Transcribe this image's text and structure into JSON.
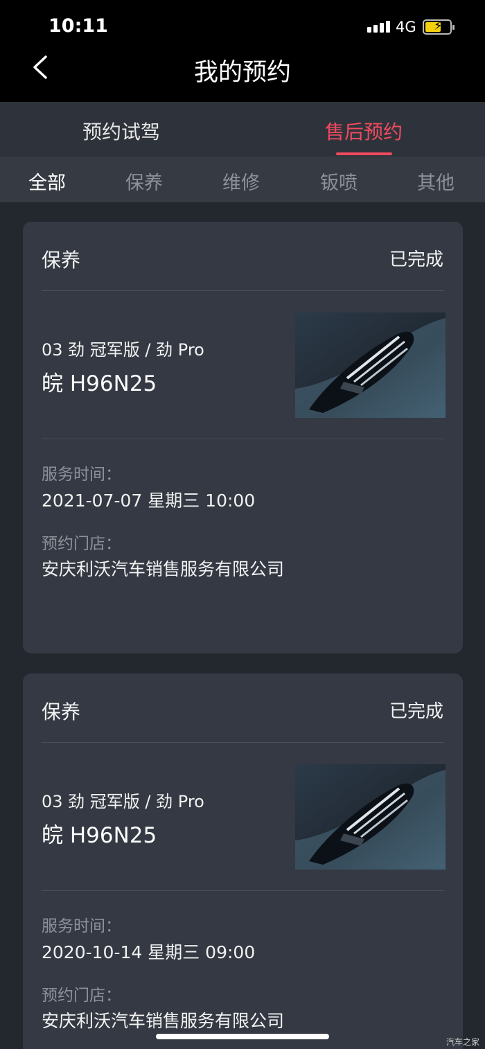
{
  "status_bar": {
    "time": "10:11",
    "network": "4G"
  },
  "header": {
    "title": "我的预约"
  },
  "tabs": [
    {
      "label": "预约试驾"
    },
    {
      "label": "售后预约"
    }
  ],
  "filters": [
    {
      "label": "全部"
    },
    {
      "label": "保养"
    },
    {
      "label": "维修"
    },
    {
      "label": "钣喷"
    },
    {
      "label": "其他"
    }
  ],
  "cards": [
    {
      "type": "保养",
      "status": "已完成",
      "model": "03 劲 冠军版 / 劲 Pro",
      "plate": "皖 H96N25",
      "time_label": "服务时间：",
      "time": "2021-07-07 星期三 10:00",
      "store_label": "预约门店：",
      "store": "安庆利沃汽车销售服务有限公司"
    },
    {
      "type": "保养",
      "status": "已完成",
      "model": "03 劲 冠军版 / 劲 Pro",
      "plate": "皖 H96N25",
      "time_label": "服务时间：",
      "time": "2020-10-14 星期三 09:00",
      "store_label": "预约门店：",
      "store": "安庆利沃汽车销售服务有限公司"
    }
  ],
  "watermark": "汽车之家",
  "colors": {
    "accent": "#f04a5e",
    "background": "#23272e",
    "card": "#343943",
    "battery": "#f4d10e"
  }
}
